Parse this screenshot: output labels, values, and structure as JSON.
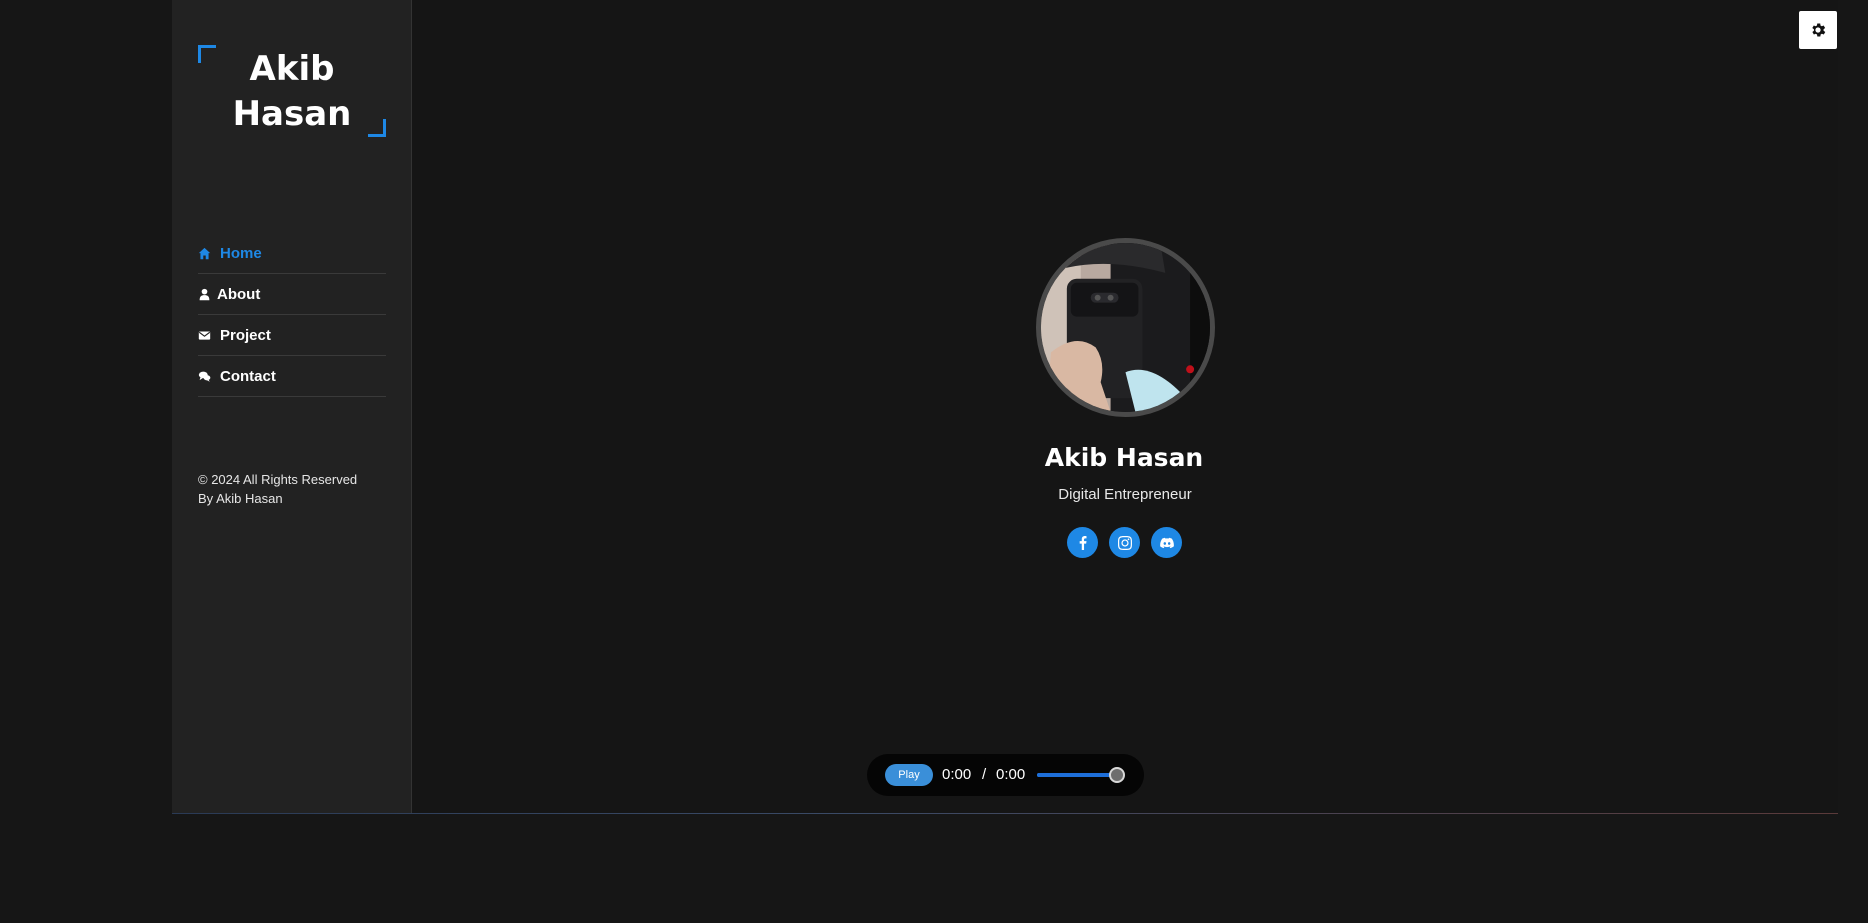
{
  "sidebar": {
    "logo_text": "Akib Hasan",
    "nav": [
      {
        "label": "Home",
        "icon": "home-icon",
        "active": true
      },
      {
        "label": "About",
        "icon": "user-icon",
        "active": false
      },
      {
        "label": "Project",
        "icon": "envelope-icon",
        "active": false
      },
      {
        "label": "Contact",
        "icon": "comments-icon",
        "active": false
      }
    ],
    "copyright_line1": "© 2024 All Rights Reserved",
    "copyright_line2": "By Akib Hasan"
  },
  "profile": {
    "name": "Akib Hasan",
    "role": "Digital Entrepreneur",
    "socials": [
      "facebook-icon",
      "instagram-icon",
      "discord-icon"
    ]
  },
  "player": {
    "play_label": "Play",
    "current_time": "0:00",
    "separator": "/",
    "duration": "0:00",
    "seek_fraction": 1.0
  },
  "settings": {
    "icon": "gear-icon"
  },
  "colors": {
    "accent": "#1e88e5",
    "background": "#161616",
    "sidebar": "#222222"
  }
}
